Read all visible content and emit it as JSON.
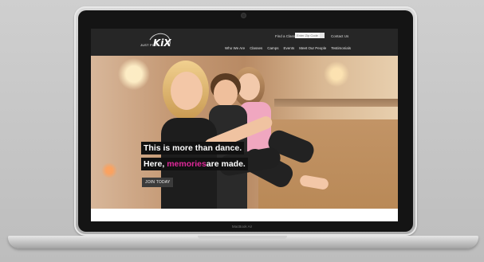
{
  "device": {
    "model_label": "MacBook Air"
  },
  "site": {
    "logo": {
      "text": "JUST FOR",
      "mark": "KiX"
    },
    "utility_bar": {
      "find_class_label": "Find a Class",
      "zip_placeholder": "Enter Zip Code",
      "contact_label": "Contact Us"
    },
    "nav": [
      {
        "label": "Who We Are"
      },
      {
        "label": "Classes"
      },
      {
        "label": "Camps"
      },
      {
        "label": "Events"
      },
      {
        "label": "Meet Our People"
      },
      {
        "label": "Testimonials"
      }
    ],
    "hero": {
      "line1": "This is more than dance.",
      "line2_start": "Here, ",
      "line2_accent": "memories",
      "line2_end": "are made.",
      "cta": "JOIN TODAY"
    }
  },
  "colors": {
    "header_bg": "#262626",
    "accent": "#e0289a",
    "headline_bg": "#111111"
  }
}
